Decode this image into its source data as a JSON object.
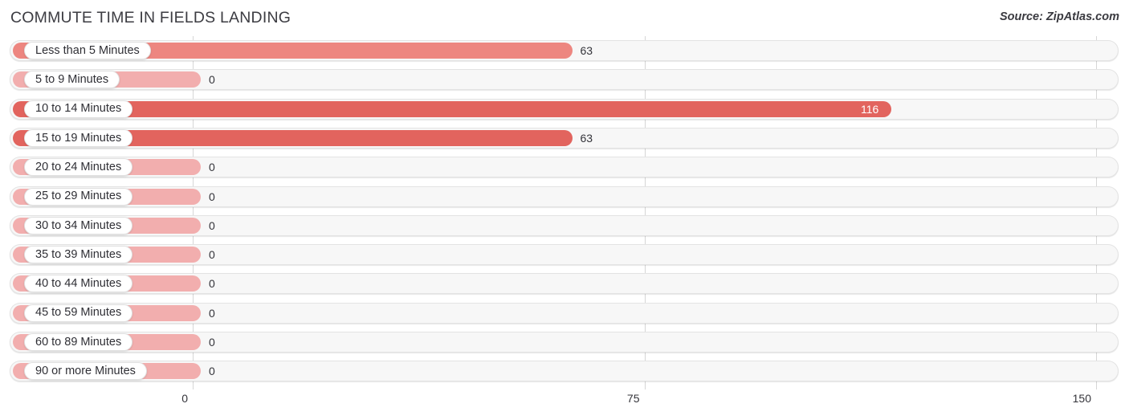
{
  "header": {
    "title": "COMMUTE TIME IN FIELDS LANDING",
    "source": "Source: ZipAtlas.com"
  },
  "colors": {
    "bar_high": "#e2645e",
    "bar_mid": "#ed8680",
    "bar_zero": "#f2aeae",
    "track_fill": "#f7f7f7",
    "track_border": "#e3e3e3",
    "gridline": "#d6d6d6",
    "text_dark": "#34343a",
    "text_on_bar": "#ffffff"
  },
  "chart_data": {
    "type": "bar",
    "orientation": "horizontal",
    "title": "COMMUTE TIME IN FIELDS LANDING",
    "xlabel": "",
    "ylabel": "",
    "xlim": [
      0,
      150
    ],
    "xticks": [
      0,
      75,
      150
    ],
    "xtick_labels": [
      "0",
      "75",
      "150"
    ],
    "grid": true,
    "legend": false,
    "categories": [
      "Less than 5 Minutes",
      "5 to 9 Minutes",
      "10 to 14 Minutes",
      "15 to 19 Minutes",
      "20 to 24 Minutes",
      "25 to 29 Minutes",
      "30 to 34 Minutes",
      "35 to 39 Minutes",
      "40 to 44 Minutes",
      "45 to 59 Minutes",
      "60 to 89 Minutes",
      "90 or more Minutes"
    ],
    "values": [
      63,
      0,
      116,
      63,
      0,
      0,
      0,
      0,
      0,
      0,
      0,
      0
    ],
    "value_labels": [
      "63",
      "0",
      "116",
      "63",
      "0",
      "0",
      "0",
      "0",
      "0",
      "0",
      "0",
      "0"
    ]
  },
  "rows": [
    {
      "label": "Less than 5 Minutes",
      "value": 63,
      "value_label": "63",
      "label_inside": false,
      "tone": "mid"
    },
    {
      "label": "5 to 9 Minutes",
      "value": 0,
      "value_label": "0",
      "label_inside": false,
      "tone": "zero"
    },
    {
      "label": "10 to 14 Minutes",
      "value": 116,
      "value_label": "116",
      "label_inside": true,
      "tone": "high"
    },
    {
      "label": "15 to 19 Minutes",
      "value": 63,
      "value_label": "63",
      "label_inside": false,
      "tone": "high"
    },
    {
      "label": "20 to 24 Minutes",
      "value": 0,
      "value_label": "0",
      "label_inside": false,
      "tone": "zero"
    },
    {
      "label": "25 to 29 Minutes",
      "value": 0,
      "value_label": "0",
      "label_inside": false,
      "tone": "zero"
    },
    {
      "label": "30 to 34 Minutes",
      "value": 0,
      "value_label": "0",
      "label_inside": false,
      "tone": "zero"
    },
    {
      "label": "35 to 39 Minutes",
      "value": 0,
      "value_label": "0",
      "label_inside": false,
      "tone": "zero"
    },
    {
      "label": "40 to 44 Minutes",
      "value": 0,
      "value_label": "0",
      "label_inside": false,
      "tone": "zero"
    },
    {
      "label": "45 to 59 Minutes",
      "value": 0,
      "value_label": "0",
      "label_inside": false,
      "tone": "zero"
    },
    {
      "label": "60 to 89 Minutes",
      "value": 0,
      "value_label": "0",
      "label_inside": false,
      "tone": "zero"
    },
    {
      "label": "90 or more Minutes",
      "value": 0,
      "value_label": "0",
      "label_inside": false,
      "tone": "zero"
    }
  ],
  "axis": {
    "ticks": [
      {
        "label": "0",
        "value": 0
      },
      {
        "label": "75",
        "value": 75
      },
      {
        "label": "150",
        "value": 150
      }
    ]
  }
}
